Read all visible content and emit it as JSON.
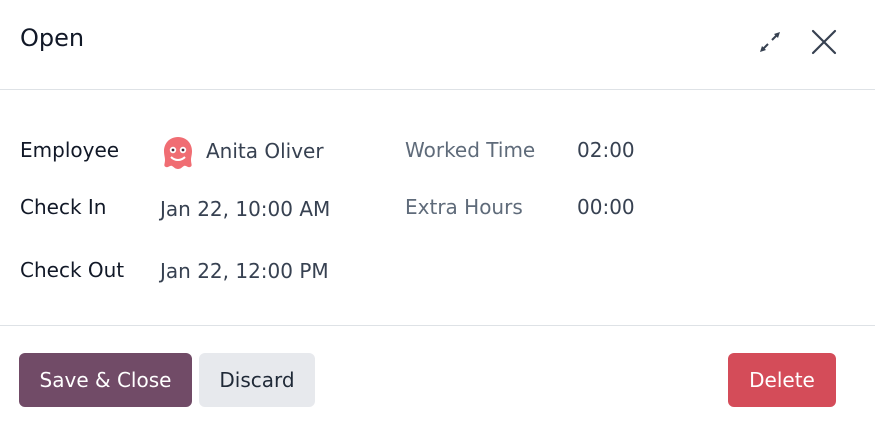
{
  "dialog": {
    "title": "Open",
    "icons": {
      "expand": "expand-icon",
      "close": "close-icon"
    }
  },
  "form": {
    "employee": {
      "label": "Employee",
      "value": "Anita Oliver",
      "avatar_icon": "ghost-avatar-icon",
      "avatar_color": "#f06d73"
    },
    "check_in": {
      "label": "Check In",
      "value": "Jan 22, 10:00 AM"
    },
    "check_out": {
      "label": "Check Out",
      "value": "Jan 22, 12:00 PM"
    },
    "worked_time": {
      "label": "Worked Time",
      "value": "02:00"
    },
    "extra_hours": {
      "label": "Extra Hours",
      "value": "00:00"
    }
  },
  "footer": {
    "save_close": "Save & Close",
    "discard": "Discard",
    "delete": "Delete"
  },
  "colors": {
    "primary": "#714b67",
    "secondary": "#e7e9ed",
    "danger": "#d44c59"
  }
}
